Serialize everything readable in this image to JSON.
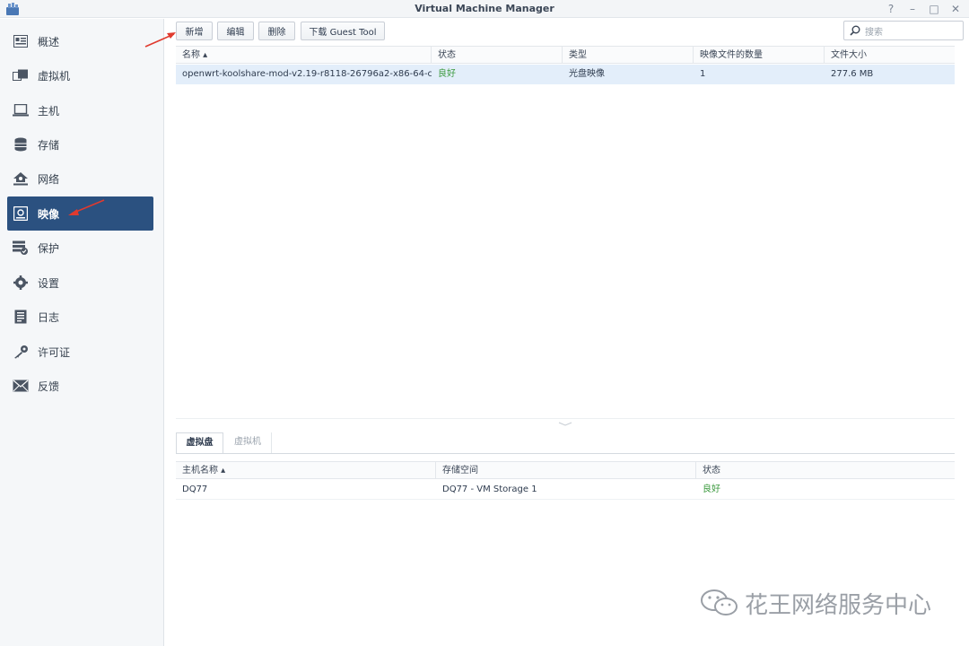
{
  "window": {
    "title": "Virtual Machine Manager",
    "controls": [
      "?",
      "–",
      "□",
      "✕"
    ]
  },
  "sidebar": {
    "items": [
      {
        "label": "概述",
        "icon": "overview-icon"
      },
      {
        "label": "虚拟机",
        "icon": "vm-icon"
      },
      {
        "label": "主机",
        "icon": "host-icon"
      },
      {
        "label": "存储",
        "icon": "storage-icon"
      },
      {
        "label": "网络",
        "icon": "network-icon"
      },
      {
        "label": "映像",
        "icon": "image-icon",
        "active": true
      },
      {
        "label": "保护",
        "icon": "protection-icon"
      },
      {
        "label": "设置",
        "icon": "settings-icon"
      },
      {
        "label": "日志",
        "icon": "log-icon"
      },
      {
        "label": "许可证",
        "icon": "license-icon"
      },
      {
        "label": "反馈",
        "icon": "feedback-icon"
      }
    ]
  },
  "toolbar": {
    "add_label": "新增",
    "edit_label": "编辑",
    "delete_label": "删除",
    "download_label": "下载 Guest Tool",
    "search_placeholder": "搜索"
  },
  "images_table": {
    "columns": [
      "名称 ▴",
      "状态",
      "类型",
      "映像文件的数量",
      "文件大小"
    ],
    "rows": [
      {
        "name": "openwrt-koolshare-mod-v2.19-r8118-26796a2-x86-64-c...",
        "status": "良好",
        "type": "光盘映像",
        "count": "1",
        "size": "277.6 MB"
      }
    ]
  },
  "detail": {
    "tabs": [
      "虚拟盘",
      "虚拟机"
    ],
    "columns": [
      "主机名称 ▴",
      "存储空间",
      "状态"
    ],
    "rows": [
      {
        "host": "DQ77",
        "storage": "DQ77 - VM Storage 1",
        "status": "良好"
      }
    ]
  },
  "watermark": {
    "text": "花王网络服务中心"
  },
  "colors": {
    "accent": "#2b5180",
    "good": "#3c9a3f",
    "arrow": "#e03a2e"
  }
}
